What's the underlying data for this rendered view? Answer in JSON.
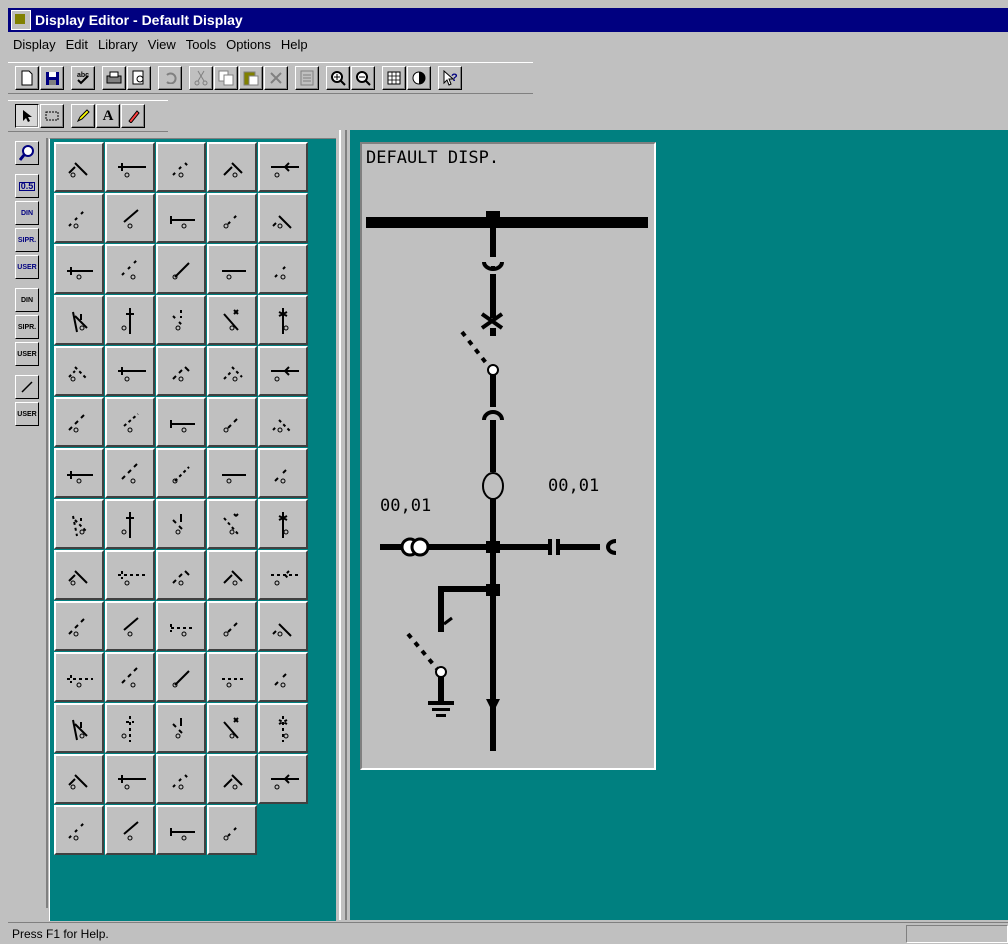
{
  "window": {
    "title": "Display Editor - Default Display",
    "icon": "display-editor-app-icon"
  },
  "menu": [
    "Display",
    "Edit",
    "Library",
    "View",
    "Tools",
    "Options",
    "Help"
  ],
  "toolbar_main": [
    "new-icon",
    "save-icon",
    "spellcheck-icon",
    "print-icon",
    "print-preview-icon",
    "undo-icon",
    "cut-icon",
    "copy-icon",
    "paste-icon",
    "delete-icon",
    "properties-icon",
    "zoom-in-icon",
    "zoom-out-icon",
    "grid-icon",
    "contrast-icon",
    "help-icon"
  ],
  "toolbar_draw": {
    "text_tool_label": "A"
  },
  "left_tools": [
    {
      "name": "zoom-icon",
      "label": ""
    },
    {
      "name": "scale-0-5",
      "label": "0.5"
    },
    {
      "name": "lib-din",
      "label": "DIN"
    },
    {
      "name": "lib-sipr",
      "label": "SIPR."
    },
    {
      "name": "lib-user",
      "label": "USER"
    },
    {
      "name": "lib-din-2",
      "label": "DIN"
    },
    {
      "name": "lib-sipr-2",
      "label": "SIPR."
    },
    {
      "name": "lib-user-2",
      "label": "USER"
    },
    {
      "name": "line-icon",
      "label": ""
    },
    {
      "name": "lib-user-line",
      "label": "USER"
    }
  ],
  "library_symbol_count": 69,
  "display": {
    "title": "DEFAULT DISP.",
    "left_value": "00,01",
    "right_value": "00,01"
  },
  "status": {
    "text": "Press F1 for Help."
  }
}
